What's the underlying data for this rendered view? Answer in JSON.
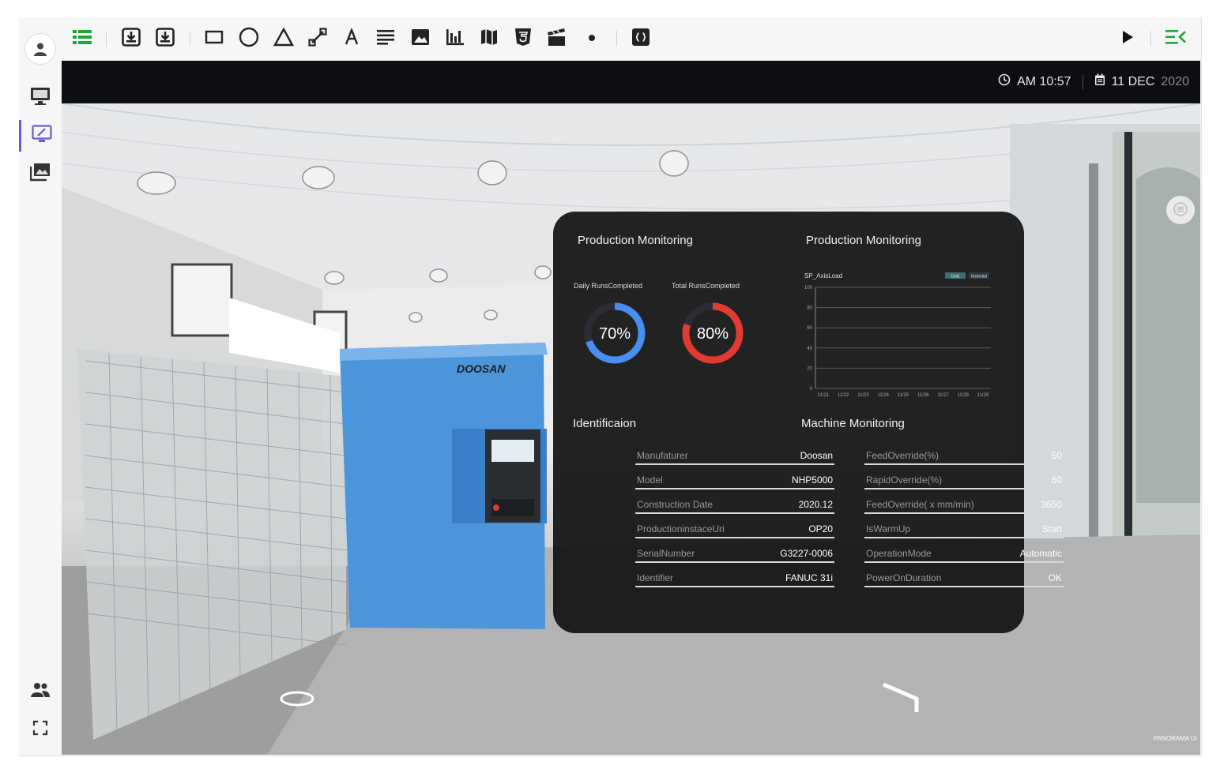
{
  "toolbar": {
    "left_icons": [
      "list-icon",
      "import-icon",
      "export-icon",
      "rectangle-icon",
      "circle-icon",
      "triangle-icon",
      "line-icon",
      "text-icon",
      "paragraph-icon",
      "image-icon",
      "bar-chart-icon",
      "map-icon",
      "html5-icon",
      "video-icon",
      "dot-icon",
      "code-icon"
    ],
    "right_icons": [
      "play-icon",
      "menu-collapse-icon"
    ]
  },
  "sidebar": {
    "icons": [
      "user-icon",
      "monitor-icon",
      "edit-screen-icon",
      "gallery-icon",
      "team-icon",
      "fullscreen-icon"
    ],
    "active": "edit-screen-icon"
  },
  "topbar": {
    "time": "AM 10:57",
    "date": "11 DEC",
    "year": "2020"
  },
  "scene": {
    "machine_brand": "DOOSAN",
    "watermark": "PANORAMA UI"
  },
  "panel": {
    "left_title": "Production Monitoring",
    "right_title": "Production Monitoring",
    "daily_label": "Daily RunsCompleted",
    "total_label": "Total RunsCompleted",
    "daily_value": "70%",
    "total_value": "80%",
    "daily_fraction": 0.7,
    "total_fraction": 0.8,
    "daily_color": "#4a8cf0",
    "total_color": "#e03a33",
    "identification_title": "Identificaion",
    "machine_title": "Machine Monitoring",
    "identification": [
      {
        "key": "Manufaturer",
        "value": "Doosan"
      },
      {
        "key": "Model",
        "value": "NHP5000"
      },
      {
        "key": "Construction Date",
        "value": "2020.12"
      },
      {
        "key": "ProductioninstaceUri",
        "value": "OP20"
      },
      {
        "key": "SerialNumber",
        "value": "G3227-0006"
      },
      {
        "key": "Identifier",
        "value": "FANUC 31i"
      }
    ],
    "machine": [
      {
        "key": "FeedOverride(%)",
        "value": "50"
      },
      {
        "key": "RapidOverride(%)",
        "value": "60"
      },
      {
        "key": "FeedOverride( x mm/min)",
        "value": "3650"
      },
      {
        "key": "IsWarmUp",
        "value": "Start"
      },
      {
        "key": "OperationMode",
        "value": "Automatic"
      },
      {
        "key": "PowerOnDuration",
        "value": "OK"
      }
    ]
  },
  "chart_data": {
    "type": "line",
    "title": "SP_AxisLoad",
    "legend": [
      "Daily",
      "Instantial"
    ],
    "legend_position": "top-right",
    "yticks": [
      "0",
      "20",
      "40",
      "60",
      "80",
      "100"
    ],
    "ylim": [
      0,
      100
    ],
    "xticks": [
      "11/21",
      "11/22",
      "11/23",
      "11/24",
      "11/25",
      "11/26",
      "11/27",
      "11/28",
      "11/29"
    ],
    "grid": true,
    "series": []
  }
}
